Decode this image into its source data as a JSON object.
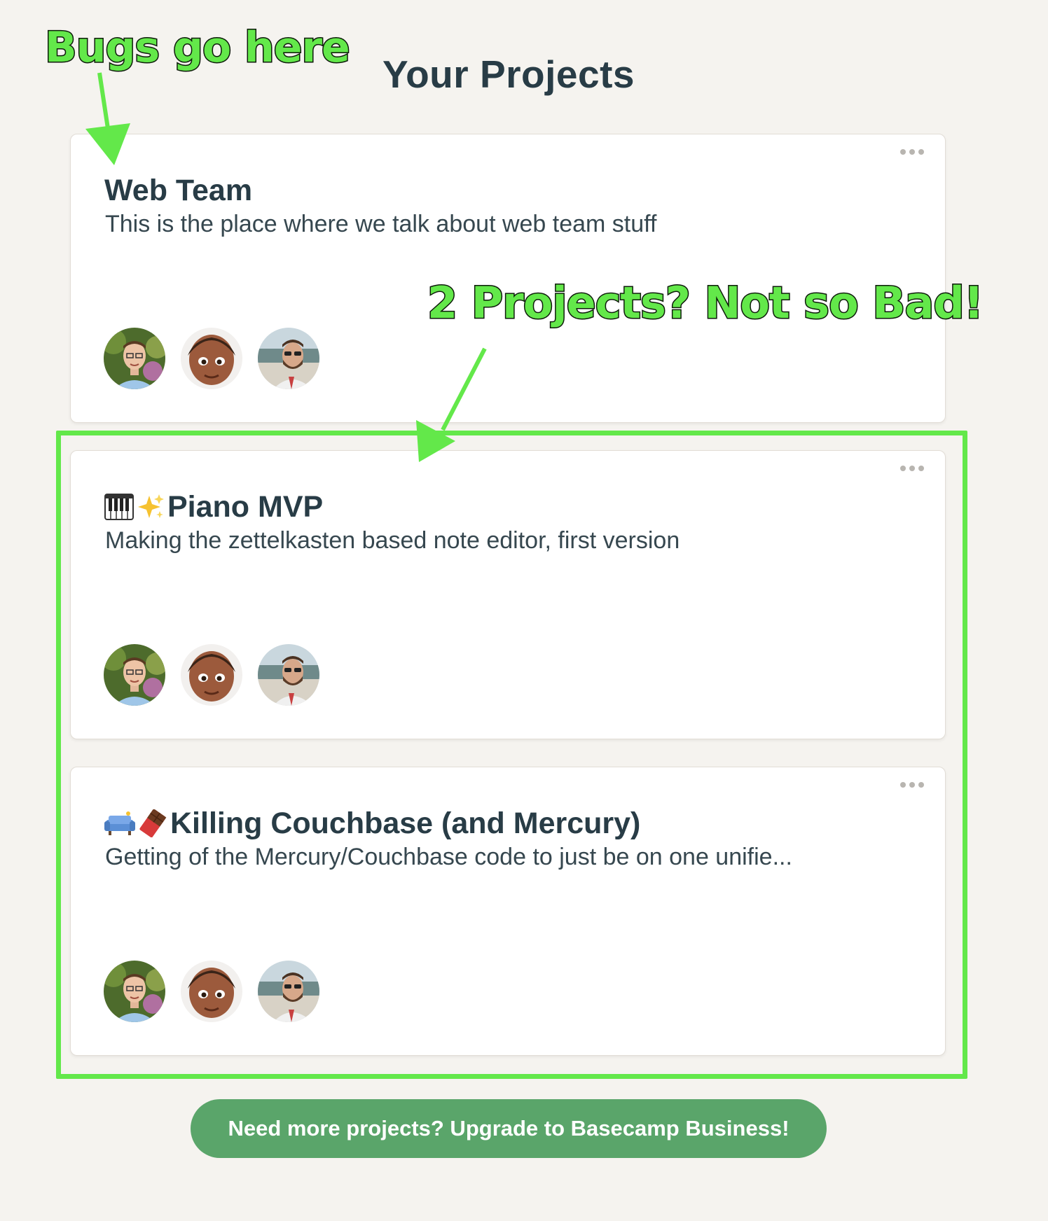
{
  "page": {
    "title": "Your Projects"
  },
  "annotations": {
    "bugs_label": "Bugs go here",
    "projects_label": "2 Projects? Not so Bad!",
    "color": "#63e84a"
  },
  "projects": [
    {
      "title": "Web Team",
      "emoji": [],
      "description": "This is the place where we talk about web team stuff",
      "menu_icon": "ellipsis-icon",
      "avatars": [
        "avatar-person-1",
        "avatar-person-2",
        "avatar-person-3"
      ]
    },
    {
      "title": "Piano MVP",
      "emoji": [
        "piano-keys-icon",
        "sparkles-icon"
      ],
      "description": "Making the zettelkasten based note editor, first version",
      "menu_icon": "ellipsis-icon",
      "avatars": [
        "avatar-person-1",
        "avatar-person-2",
        "avatar-person-3"
      ]
    },
    {
      "title": "Killing Couchbase (and Mercury)",
      "emoji": [
        "couch-icon",
        "chocolate-bar-icon"
      ],
      "description": "Getting of the Mercury/Couchbase code to just be on one unifie...",
      "menu_icon": "ellipsis-icon",
      "avatars": [
        "avatar-person-1",
        "avatar-person-2",
        "avatar-person-3"
      ]
    }
  ],
  "upgrade": {
    "label": "Need more projects? Upgrade to Basecamp Business!"
  },
  "colors": {
    "background": "#f5f3ef",
    "heading": "#283c46",
    "button": "#5aa56a",
    "highlight": "#63e84a"
  }
}
